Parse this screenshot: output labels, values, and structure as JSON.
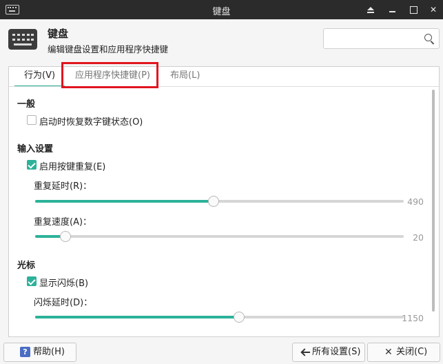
{
  "window": {
    "title": "键盘"
  },
  "header": {
    "title": "键盘",
    "subtitle": "编辑键盘设置和应用程序快捷键",
    "search_placeholder": ""
  },
  "tabs": [
    {
      "label": "行为(V)",
      "active": true
    },
    {
      "label": "应用程序快捷键(P)",
      "active": false
    },
    {
      "label": "布局(L)",
      "active": false
    }
  ],
  "general": {
    "heading": "一般",
    "restore_numlock": {
      "label": "启动时恢复数字键状态(O)",
      "checked": false
    }
  },
  "input": {
    "heading": "输入设置",
    "key_repeat": {
      "label": "启用按键重复(E)",
      "checked": true
    },
    "repeat_delay": {
      "label": "重复延时(R)：",
      "value": "490",
      "fraction": 0.485
    },
    "repeat_speed": {
      "label": "重复速度(A)：",
      "value": "20",
      "fraction": 0.083
    }
  },
  "cursor": {
    "heading": "光标",
    "show_blink": {
      "label": "显示闪烁(B)",
      "checked": true
    },
    "blink_delay": {
      "label": "闪烁延时(D)：",
      "value": "1150",
      "fraction": 0.553
    }
  },
  "buttons": {
    "help": "帮助(H)",
    "all_settings": "所有设置(S)",
    "close": "关闭(C)"
  },
  "colors": {
    "accent": "#2cb29a",
    "highlight": "#e0141e",
    "titlebar": "#2b2b2b"
  }
}
